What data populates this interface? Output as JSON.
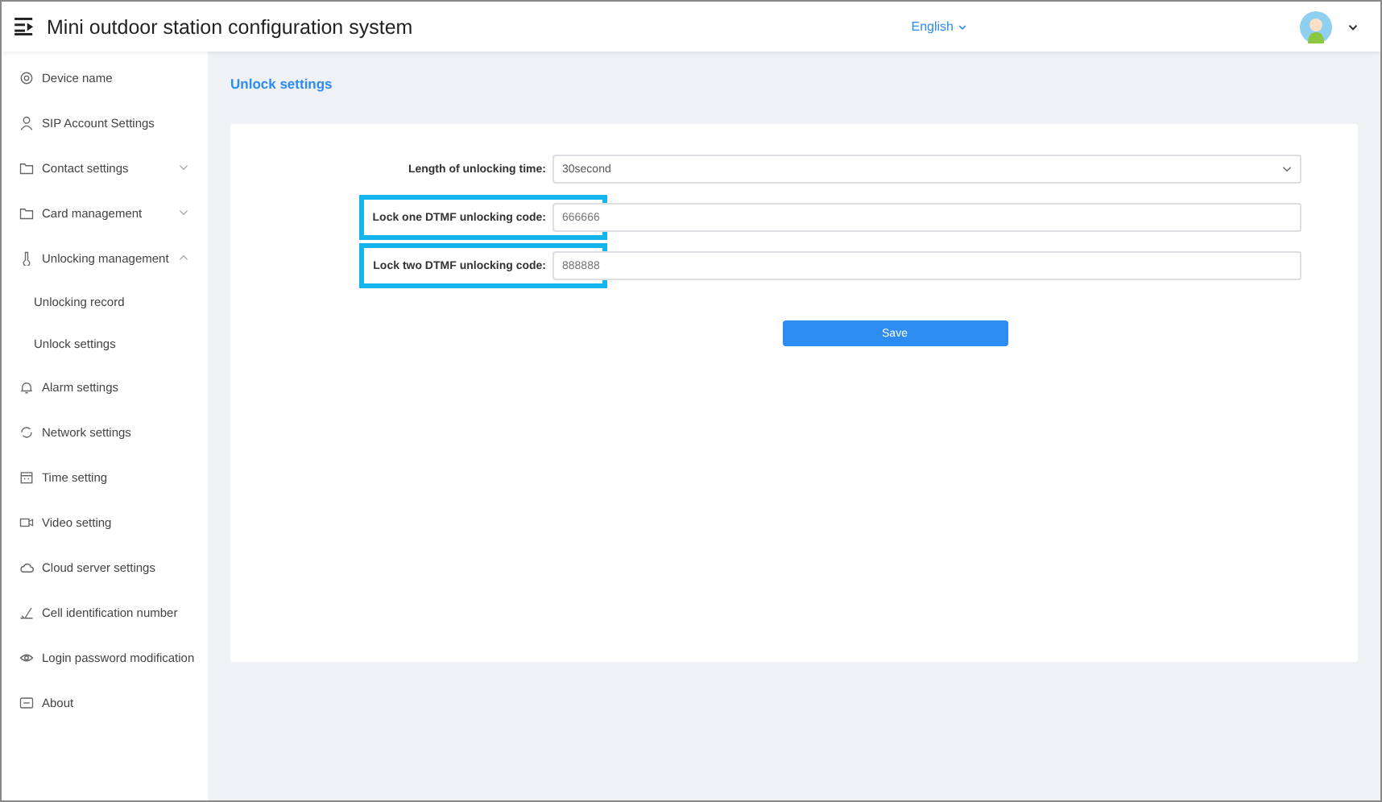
{
  "header": {
    "title": "Mini outdoor station configuration system",
    "language": "English"
  },
  "sidebar": {
    "items": [
      {
        "label": "Device name"
      },
      {
        "label": "SIP Account Settings"
      },
      {
        "label": "Contact settings",
        "expanded": false
      },
      {
        "label": "Card management",
        "expanded": false
      },
      {
        "label": "Unlocking management",
        "expanded": true,
        "children": [
          {
            "label": "Unlocking record"
          },
          {
            "label": "Unlock settings"
          }
        ]
      },
      {
        "label": "Alarm settings"
      },
      {
        "label": "Network settings"
      },
      {
        "label": "Time setting"
      },
      {
        "label": "Video setting"
      },
      {
        "label": "Cloud server settings"
      },
      {
        "label": "Cell identification number"
      },
      {
        "label": "Login password modification"
      },
      {
        "label": "About"
      }
    ]
  },
  "page_title": "Unlock settings",
  "form": {
    "fields": [
      {
        "kind": "select",
        "label": "Length of unlocking time:",
        "value": "30second",
        "highlighted": false
      },
      {
        "kind": "text",
        "label": "Lock one DTMF unlocking code:",
        "value": "666666",
        "highlighted": true
      },
      {
        "kind": "text",
        "label": "Lock two DTMF unlocking code:",
        "value": "888888",
        "highlighted": true
      }
    ],
    "button": "Save"
  }
}
